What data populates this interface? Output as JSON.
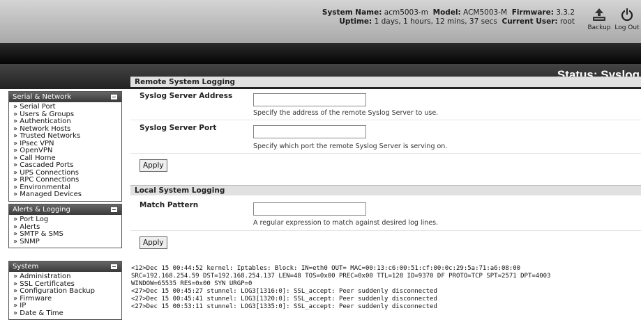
{
  "header": {
    "system_name_label": "System Name:",
    "system_name": "acm5003-m",
    "model_label": "Model:",
    "model": "ACM5003-M",
    "firmware_label": "Firmware:",
    "firmware": "3.3.2",
    "uptime_label": "Uptime:",
    "uptime": "1 days, 1 hours, 12 mins, 37 secs",
    "current_user_label": "Current User:",
    "current_user": "root",
    "backup_label": "Backup",
    "logout_label": "Log Out"
  },
  "page_title": "Status: Syslog",
  "sidebar": {
    "serial_network": {
      "title": "Serial & Network",
      "items": [
        "Serial Port",
        "Users & Groups",
        "Authentication",
        "Network Hosts",
        "Trusted Networks",
        "IPsec VPN",
        "OpenVPN",
        "Call Home",
        "Cascaded Ports",
        "UPS Connections",
        "RPC Connections",
        "Environmental",
        "Managed Devices"
      ]
    },
    "alerts_logging": {
      "title": "Alerts & Logging",
      "items": [
        "Port Log",
        "Alerts",
        "SMTP & SMS",
        "SNMP"
      ]
    },
    "system": {
      "title": "System",
      "items": [
        "Administration",
        "SSL Certificates",
        "Configuration Backup",
        "Firmware",
        "IP",
        "Date & Time"
      ]
    }
  },
  "remote": {
    "section_title": "Remote System Logging",
    "server_address_label": "Syslog Server Address",
    "server_address_value": "",
    "server_address_help": "Specify the address of the remote Syslog Server to use.",
    "server_port_label": "Syslog Server Port",
    "server_port_value": "",
    "server_port_help": "Specify which port the remote Syslog Server is serving on.",
    "apply_label": "Apply"
  },
  "local": {
    "section_title": "Local System Logging",
    "match_pattern_label": "Match Pattern",
    "match_pattern_value": "",
    "match_pattern_help": "A regular expression to match against desired log lines.",
    "apply_label": "Apply"
  },
  "log_lines": [
    "<12>Dec 15 00:44:52 kernel: Iptables: Block: IN=eth0 OUT= MAC=00:13:c6:00:51:cf:00:0c:29:5a:71:a6:08:00",
    "SRC=192.168.254.59 DST=192.168.254.137 LEN=48 TOS=0x00 PREC=0x00 TTL=128 ID=9370 DF PROTO=TCP SPT=2571 DPT=4003",
    "WINDOW=65535 RES=0x00 SYN URGP=0",
    "<27>Dec 15 00:45:27 stunnel: LOG3[1316:0]: SSL_accept: Peer suddenly disconnected",
    "<27>Dec 15 00:45:41 stunnel: LOG3[1320:0]: SSL_accept: Peer suddenly disconnected",
    "<27>Dec 15 00:53:11 stunnel: LOG3[1335:0]: SSL_accept: Peer suddenly disconnected"
  ]
}
